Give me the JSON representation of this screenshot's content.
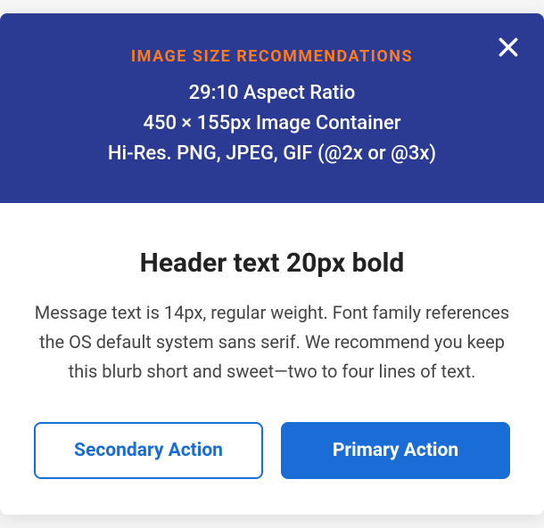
{
  "banner": {
    "title": "IMAGE SIZE RECOMMENDATIONS",
    "line1": "29:10 Aspect Ratio",
    "line2": "450 × 155px Image Container",
    "line3": "Hi-Res. PNG, JPEG, GIF (@2x or @3x)"
  },
  "content": {
    "header": "Header text 20px bold",
    "message": "Message text is 14px, regular weight. Font family references the OS default system sans serif. We recommend you keep this blurb short and sweet—two to four lines of text."
  },
  "buttons": {
    "secondary": "Secondary Action",
    "primary": "Primary Action"
  },
  "colors": {
    "banner_bg": "#2b3b94",
    "accent_orange": "#ff7a1a",
    "primary_blue": "#1a6dd6"
  }
}
